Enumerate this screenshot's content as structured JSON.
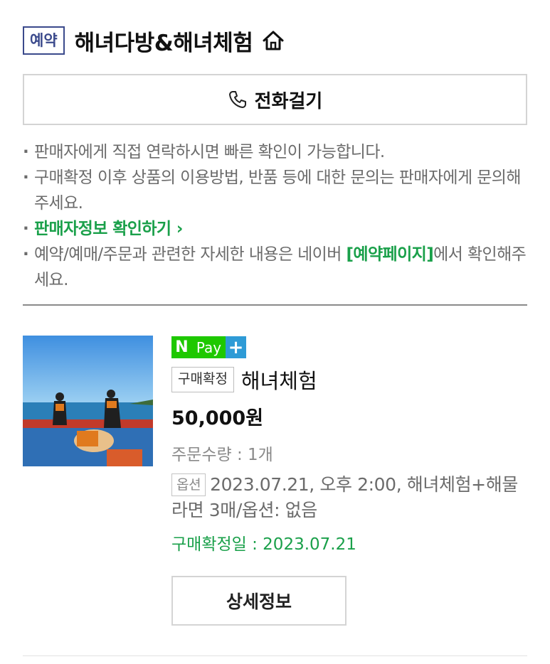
{
  "header": {
    "badge": "예약",
    "store_name": "해녀다방&해녀체험",
    "home_icon": "home-icon"
  },
  "call_button": {
    "icon": "phone-icon",
    "label": "전화걸기"
  },
  "notes": {
    "line1": "판매자에게 직접 연락하시면 빠른 확인이 가능합니다.",
    "line2": "구매확정 이후 상품의 이용방법, 반품 등에 대한 문의는 판매자에게 문의해 주세요.",
    "seller_info_link": "판매자정보 확인하기",
    "line4_prefix": "예약/예매/주문과 관련한 자세한 내용은 네이버 ",
    "line4_link": "[예약페이지]",
    "line4_suffix": "에서 확인해주세요."
  },
  "order": {
    "npay": {
      "n": "N",
      "pay": "Pay",
      "plus": "+"
    },
    "status": "구매확정",
    "product_name": "해녀체험",
    "price": "50,000원",
    "quantity": "주문수량 : 1개",
    "option_tag": "옵션",
    "option_text": "2023.07.21, 오후 2:00, 해녀체험+해물라면 3매/옵션: 없음",
    "confirm_date": "구매확정일 : 2023.07.21",
    "detail_button": "상세정보"
  },
  "colors": {
    "accent_green": "#1aa04a",
    "npay_green": "#1ec800",
    "npay_blue": "#2e9bd6",
    "badge_navy": "#3b4a8c"
  }
}
